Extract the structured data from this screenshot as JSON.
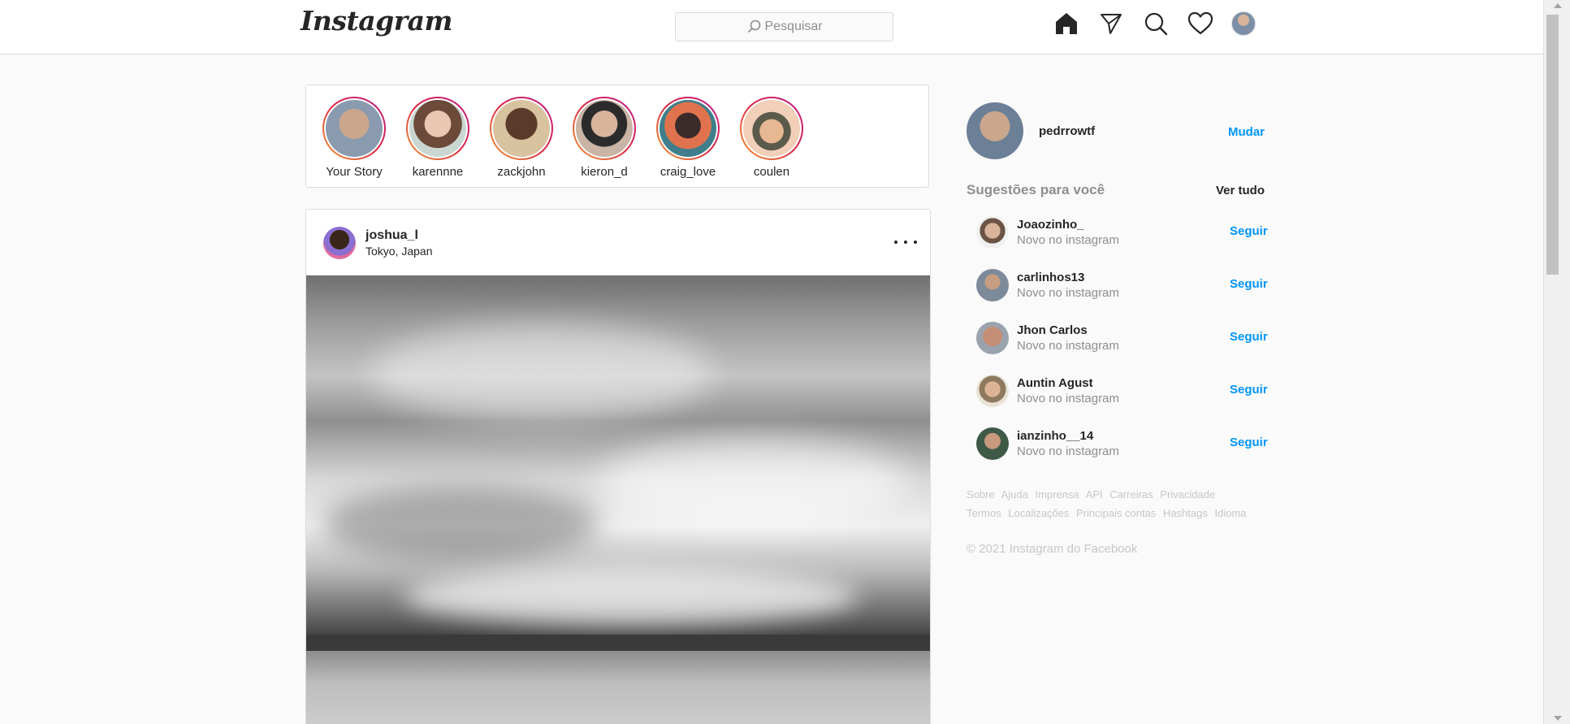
{
  "header": {
    "logo": "Instagram",
    "search_placeholder": "Pesquisar"
  },
  "stories": [
    {
      "label": "Your Story",
      "color": "#8a9bb0"
    },
    {
      "label": "karennne",
      "color": "#c9a58e"
    },
    {
      "label": "zackjohn",
      "color": "#5a3b2a"
    },
    {
      "label": "kieron_d",
      "color": "#b99a86"
    },
    {
      "label": "craig_love",
      "color": "#3f7e8a"
    },
    {
      "label": "coulen",
      "color": "#d98d5c"
    }
  ],
  "post": {
    "username": "joshua_l",
    "location": "Tokyo, Japan"
  },
  "sidebar": {
    "username": "pedrrowtf",
    "switch_label": "Mudar",
    "suggestions_title": "Sugestões para você",
    "see_all": "Ver tudo",
    "suggestions": [
      {
        "name": "Joaozinho_",
        "subtitle": "Novo no instagram",
        "action": "Seguir",
        "color": "#6b5446"
      },
      {
        "name": "carlinhos13",
        "subtitle": "Novo no instagram",
        "action": "Seguir",
        "color": "#7d8a99"
      },
      {
        "name": "Jhon Carlos",
        "subtitle": "Novo no instagram",
        "action": "Seguir",
        "color": "#c48e76"
      },
      {
        "name": "Auntin Agust",
        "subtitle": "Novo no instagram",
        "action": "Seguir",
        "color": "#8e7a5e"
      },
      {
        "name": "ianzinho__14",
        "subtitle": "Novo no instagram",
        "action": "Seguir",
        "color": "#3e5a47"
      }
    ],
    "footer_links": [
      "Sobre",
      "Ajuda",
      "Imprensa",
      "API",
      "Carreiras",
      "Privacidade",
      "Termos",
      "Localizações",
      "Principais contas",
      "Hashtags",
      "Idioma"
    ],
    "copyright": "© 2021 Instagram do Facebook"
  },
  "colors": {
    "accent": "#0095f6",
    "border": "#dbdbdb"
  }
}
